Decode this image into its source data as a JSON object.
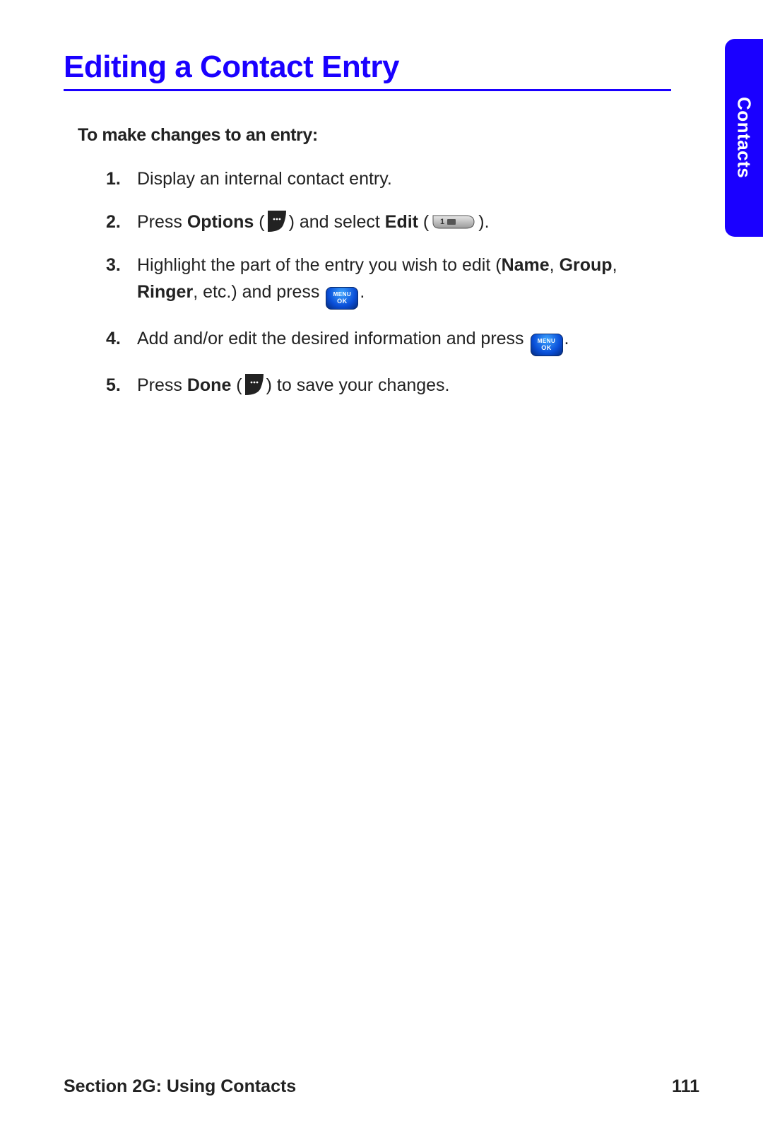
{
  "sideTab": "Contacts",
  "title": "Editing a Contact Entry",
  "intro": "To make changes to an entry:",
  "steps": {
    "s1_num": "1.",
    "s1_text": "Display an internal contact entry.",
    "s2_num": "2.",
    "s2_a": "Press ",
    "s2_options": "Options",
    "s2_b": " (",
    "s2_c": ") and select ",
    "s2_edit": "Edit",
    "s2_d": " (",
    "s2_e": ").",
    "s3_num": "3.",
    "s3_a": "Highlight the part of the entry you wish to edit (",
    "s3_name": "Name",
    "s3_c1": ", ",
    "s3_group": "Group",
    "s3_c2": ", ",
    "s3_ringer": "Ringer",
    "s3_b": ", etc.) and press ",
    "s3_c": ".",
    "s4_num": "4.",
    "s4_a": "Add and/or edit the desired information and press ",
    "s4_b": ".",
    "s5_num": "5.",
    "s5_a": "Press ",
    "s5_done": "Done",
    "s5_b": " (",
    "s5_c": ") to save your changes."
  },
  "menuok": {
    "line1": "MENU",
    "line2": "OK"
  },
  "footer": {
    "section": "Section 2G: Using Contacts",
    "page": "111"
  }
}
